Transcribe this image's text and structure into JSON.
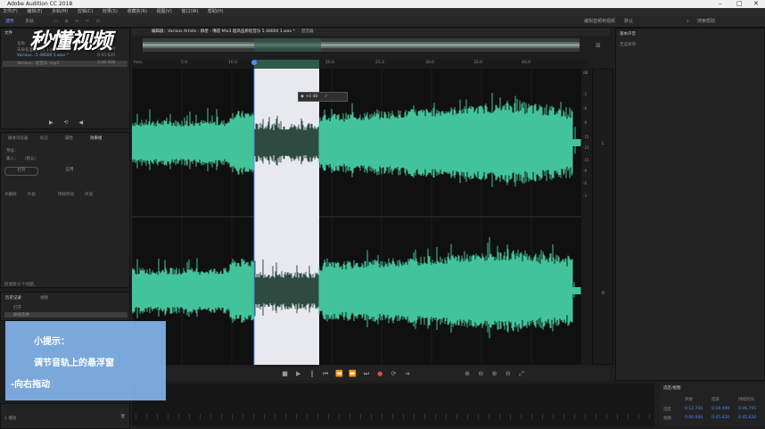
{
  "window": {
    "title": "Adobe Audition CC 2018"
  },
  "menu": [
    "文件(F)",
    "编辑(E)",
    "多轨(M)",
    "剪辑(C)",
    "效果(S)",
    "收藏夹(R)",
    "视图(V)",
    "窗口(W)",
    "帮助(H)"
  ],
  "toolbar": {
    "waveform_label": "波形",
    "multitrack_label": "多轨",
    "workspace_label": "编辑音频到视频",
    "default_label": "默认",
    "search_placeholder": "搜索帮助"
  },
  "logo": {
    "text": "秒懂视频"
  },
  "files_panel": {
    "tab": "文件",
    "columns": [
      "名称",
      "状态",
      "持续时间"
    ],
    "files": [
      {
        "name": "未命名混音项目 1.sesx *",
        "duration": "0:00.000"
      },
      {
        "name": "Various...5 48000 1.wav *",
        "duration": "0:45.620"
      },
      {
        "name": "Various...轻音乐 .mp3",
        "duration": "3:08.008"
      }
    ]
  },
  "effects_panel": {
    "tabs": [
      "媒体浏览器",
      "标记",
      "属性",
      "效果组",
      "历史记录"
    ],
    "preset_label": "预设：",
    "preset_value": "（默认）",
    "input_label": "输入：",
    "buttons": [
      "打开",
      "应用"
    ],
    "columns": [
      "大删除",
      "片段",
      "持续时间",
      "声道"
    ],
    "status": "检测到 0 个问题。"
  },
  "history_panel": {
    "tabs": [
      "历史记录",
      "视频"
    ],
    "items": [
      "打开",
      "振幅变换"
    ]
  },
  "editor": {
    "tab": "编辑器：Various Artists - 群星 - 嘴唇 Mix3 超高品质轻音乐 5 48000 1.wav *",
    "mixer_tab": "混音器",
    "ruler_labels": [
      "hms",
      "5.0",
      "10.0",
      "15.0",
      "20.0",
      "25.0",
      "30.0",
      "35.0",
      "40.0"
    ],
    "db_labels": [
      "dB",
      "-3",
      "-6",
      "-9",
      "-15",
      "-21",
      "-15",
      "-9",
      "-6",
      "-3"
    ],
    "hud_value": "+0 dB"
  },
  "essential_panel": {
    "tab": "基本声音",
    "subtitle": "无选择项"
  },
  "selection_panel": {
    "tab": "选区/视图",
    "columns": [
      "开始",
      "结束",
      "持续时间"
    ],
    "rows": [
      {
        "label": "选区",
        "start": "0:12.704",
        "end": "0:19.499",
        "dur": "0:06.795"
      },
      {
        "label": "视图",
        "start": "0:00.000",
        "end": "0:45.620",
        "dur": "0:45.620"
      }
    ]
  },
  "status_bar": {
    "text": "1 播放"
  },
  "tip": {
    "title": "小提示：",
    "line1": "调节音轨上的悬浮窗",
    "line2": "-向右拖动"
  },
  "colors": {
    "waveform": "#43c39a",
    "selection": "#e7e9ee",
    "tip": "#82b4eb"
  }
}
